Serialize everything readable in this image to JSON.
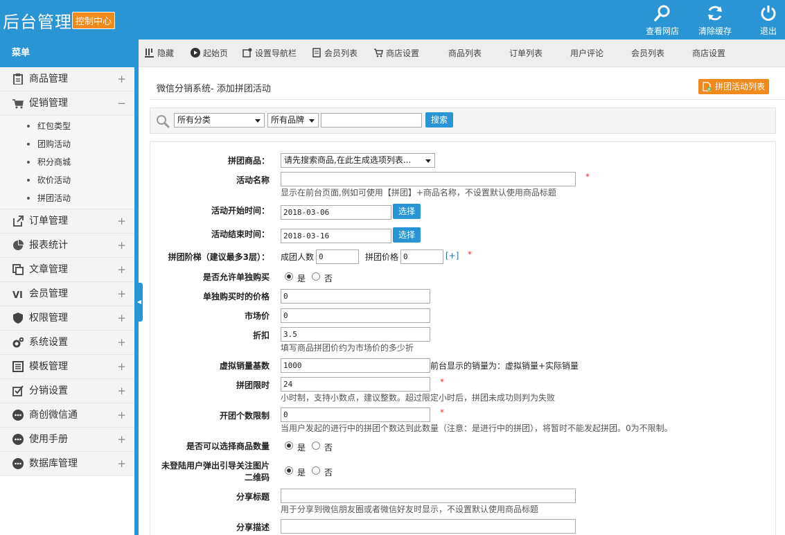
{
  "header": {
    "brand": "后台管理",
    "badge": "控制中心",
    "buttons": [
      {
        "label": "查看网店",
        "icon": "search-icon"
      },
      {
        "label": "清除缓存",
        "icon": "refresh-icon"
      },
      {
        "label": "退出",
        "icon": "power-icon"
      }
    ]
  },
  "menu_title": "菜单",
  "tabs": [
    {
      "label": "隐藏",
      "icon": "columns-icon"
    },
    {
      "label": "起始页",
      "icon": "play-icon"
    },
    {
      "label": "设置导航栏",
      "icon": "settings-nav-icon"
    },
    {
      "label": "会员列表",
      "icon": "list-icon"
    },
    {
      "label": "商店设置",
      "icon": "shop-icon"
    },
    {
      "label": "商品列表"
    },
    {
      "label": "订单列表"
    },
    {
      "label": "用户评论"
    },
    {
      "label": "会员列表"
    },
    {
      "label": "商店设置"
    }
  ],
  "sidebar": {
    "groups": [
      {
        "label": "商品管理",
        "icon": "clipboard-icon",
        "toggle": "+"
      },
      {
        "label": "促销管理",
        "icon": "cart-icon",
        "toggle": "−"
      },
      {
        "label": "订单管理",
        "icon": "external-icon",
        "toggle": "+"
      },
      {
        "label": "报表统计",
        "icon": "pie-chart-icon",
        "toggle": "+"
      },
      {
        "label": "文章管理",
        "icon": "copy-icon",
        "toggle": "+"
      },
      {
        "label": "会员管理",
        "icon": "vip-icon",
        "toggle": "+"
      },
      {
        "label": "权限管理",
        "icon": "shield-icon",
        "toggle": "+"
      },
      {
        "label": "系统设置",
        "icon": "gears-icon",
        "toggle": "+"
      },
      {
        "label": "模板管理",
        "icon": "template-icon",
        "toggle": "+"
      },
      {
        "label": "分销设置",
        "icon": "checkbox-icon",
        "toggle": "+"
      },
      {
        "label": "商创微信通",
        "icon": "more-icon",
        "toggle": "+"
      },
      {
        "label": "使用手册",
        "icon": "more-icon",
        "toggle": "+"
      },
      {
        "label": "数据库管理",
        "icon": "more-icon",
        "toggle": "+"
      }
    ],
    "promo_items": [
      "红包类型",
      "团购活动",
      "积分商城",
      "砍价活动",
      "拼团活动"
    ]
  },
  "main": {
    "title": "微信分销系统- 添加拼团活动",
    "list_button": "拼团活动列表",
    "search": {
      "category": "所有分类",
      "brand": "所有品牌",
      "keyword": "",
      "button": "搜索"
    },
    "form": {
      "goods_label": "拼团商品：",
      "goods_select": "请先搜索商品,在此生成选项列表...",
      "name_label": "活动名称",
      "name_value": "",
      "name_hint": "显示在前台页面,例如可使用【拼团】+商品名称，不设置默认使用商品标题",
      "start_label": "活动开始时间：",
      "start_value": "2018-03-06",
      "end_label": "活动结束时间：",
      "end_value": "2018-03-16",
      "choose": "选择",
      "tier_label": "拼团阶梯（建议最多3层）：",
      "tier_count_label": "成团人数",
      "tier_count_value": "0",
      "tier_price_label": "拼团价格",
      "tier_price_value": "0",
      "tier_add": "[+]",
      "single_label": "是否允许单独购买",
      "yes": "是",
      "no": "否",
      "single_price_label": "单独购买时的价格",
      "single_price_value": "0",
      "market_label": "市场价",
      "market_value": "0",
      "discount_label": "折扣",
      "discount_value": "3.5",
      "discount_hint": "填写商品拼团价约为市场价的多少折",
      "virtual_label": "虚拟销量基数",
      "virtual_value": "1000",
      "virtual_hint": "前台显示的销量为：虚拟销量+实际销量",
      "limit_label": "拼团限时",
      "limit_value": "24",
      "limit_hint": "小时制，支持小数点，建议整数。超过限定小时后，拼团未成功则判为失败",
      "group_limit_label": "开团个数限制",
      "group_limit_value": "0",
      "group_limit_hint": "当用户发起的进行中的拼团个数达到此数量（注意：是进行中的拼团），将暂时不能发起拼团。0为不限制。",
      "choose_qty_label": "是否可以选择商品数量",
      "qr_label_1": "未登陆用户弹出引导关注图片",
      "qr_label_2": "二维码",
      "share_title_label": "分享标题",
      "share_title_value": "",
      "share_title_hint": "用于分享到微信朋友圈或者微信好友时显示，不设置默认使用商品标题",
      "share_desc_label": "分享描述",
      "share_desc_value": ""
    }
  }
}
